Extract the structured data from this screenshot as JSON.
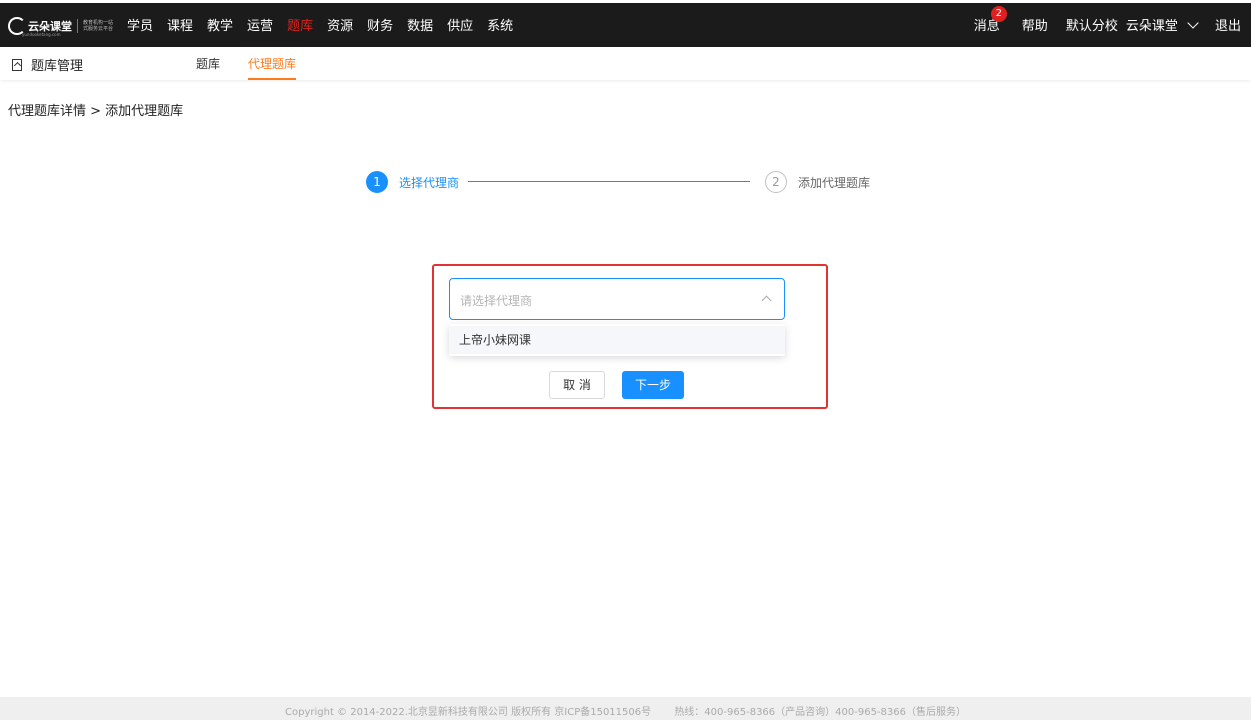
{
  "brand": {
    "name": "云朵课堂",
    "subtitle": "教育机构一站式服务云平台",
    "url": "yunduoketang.com"
  },
  "nav": {
    "items": [
      "学员",
      "课程",
      "教学",
      "运营",
      "题库",
      "资源",
      "财务",
      "数据",
      "供应",
      "系统"
    ],
    "active_index": 4
  },
  "right_nav": {
    "messages": "消息",
    "message_count": "2",
    "help": "帮助",
    "branch": "默认分校",
    "account": "云朵课堂",
    "logout": "退出"
  },
  "subheader": {
    "title": "题库管理",
    "tabs": [
      "题库",
      "代理题库"
    ],
    "active_tab": 1
  },
  "breadcrumb": "代理题库详情 > 添加代理题库",
  "steps": {
    "step1_number": "1",
    "step1_label": "选择代理商",
    "step2_number": "2",
    "step2_label": "添加代理题库"
  },
  "select": {
    "placeholder": "请选择代理商",
    "options": [
      "上帝小妹网课"
    ]
  },
  "buttons": {
    "cancel": "取 消",
    "next": "下一步"
  },
  "footer": {
    "copyright": "Copyright © 2014-2022.北京昱新科技有限公司 版权所有 京ICP备15011506号",
    "hotline": "热线：400-965-8366（产品咨询）400-965-8366（售后服务）"
  },
  "colors": {
    "primary": "#1890ff",
    "nav_active": "#d9251c",
    "tab_active": "#ff7a1a",
    "highlight_frame": "#e23232"
  }
}
